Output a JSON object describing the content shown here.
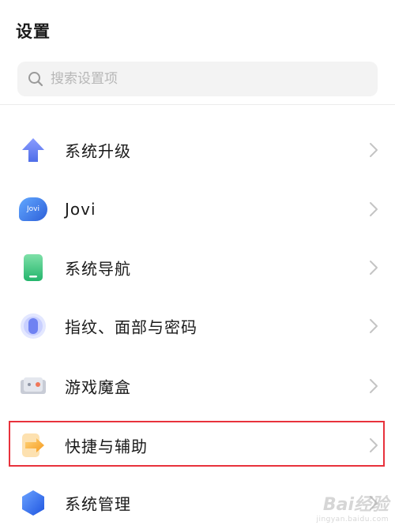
{
  "page": {
    "title": "设置"
  },
  "search": {
    "placeholder": "搜索设置项",
    "icon": "search-icon"
  },
  "items": [
    {
      "label": "系统升级",
      "icon": "system-upgrade-icon"
    },
    {
      "label": "Jovi",
      "icon": "jovi-icon",
      "icon_text": "Jovi"
    },
    {
      "label": "系统导航",
      "icon": "system-navigation-icon"
    },
    {
      "label": "指纹、面部与密码",
      "icon": "fingerprint-icon"
    },
    {
      "label": "游戏魔盒",
      "icon": "game-box-icon"
    },
    {
      "label": "快捷与辅助",
      "icon": "shortcut-assist-icon",
      "highlighted": true
    },
    {
      "label": "系统管理",
      "icon": "system-management-icon"
    }
  ],
  "watermark": {
    "text": "Bai经验",
    "sub": "jingyan.baidu.com"
  },
  "colors": {
    "highlight_border": "#e8323c",
    "upgrade_blue": "#5b7cf0",
    "jovi_blue": "#3a7be8",
    "nav_green": "#35c47a",
    "fingerprint_blue": "#7d8ff5",
    "shortcut_orange": "#f5a623",
    "manage_blue": "#2f6bf0"
  }
}
